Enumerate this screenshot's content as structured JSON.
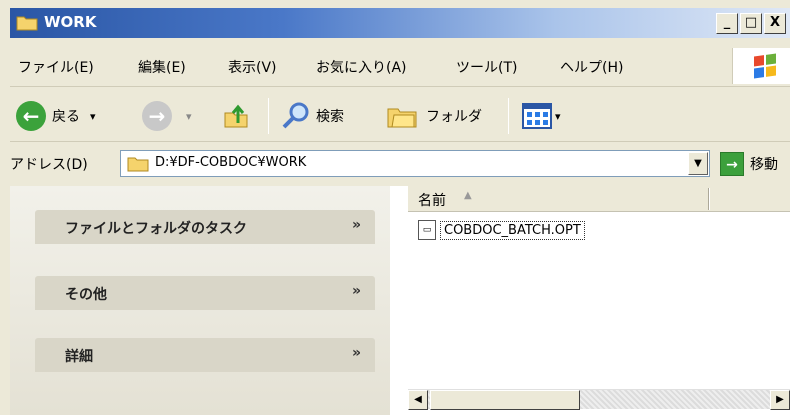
{
  "window": {
    "title": "WORK",
    "controls": {
      "minimize": "_",
      "maximize": "□",
      "close": "X"
    }
  },
  "menu": {
    "items": [
      "ファイル(E)",
      "編集(E)",
      "表示(V)",
      "お気に入り(A)",
      "ツール(T)",
      "ヘルプ(H)"
    ]
  },
  "toolbar": {
    "back_label": "戻る",
    "back_dropdown": "▾",
    "forward_dropdown": "▾",
    "search_label": "検索",
    "folders_label": "フォルダ",
    "views_dropdown": "▾",
    "icons": {
      "back": "back-arrow-icon",
      "forward": "forward-arrow-icon",
      "up": "up-folder-icon",
      "search": "magnifier-icon",
      "folders": "folder-tree-icon",
      "views": "view-grid-icon"
    }
  },
  "address": {
    "label": "アドレス(D)",
    "value": "D:¥DF-COBDOC¥WORK",
    "go_label": "移動"
  },
  "tasks": {
    "panels": [
      {
        "title": "ファイルとフォルダのタスク",
        "chevron": "»"
      },
      {
        "title": "その他",
        "chevron": "»"
      },
      {
        "title": "詳細",
        "chevron": "»"
      }
    ]
  },
  "files": {
    "column_name": "名前",
    "sort_indicator": "▲",
    "items": [
      {
        "name": "COBDOC_BATCH.OPT",
        "icon": "document-icon"
      }
    ]
  },
  "colors": {
    "title_bar": "#2a56a5",
    "chrome": "#ece9d8",
    "go_button": "#3ca03c"
  }
}
